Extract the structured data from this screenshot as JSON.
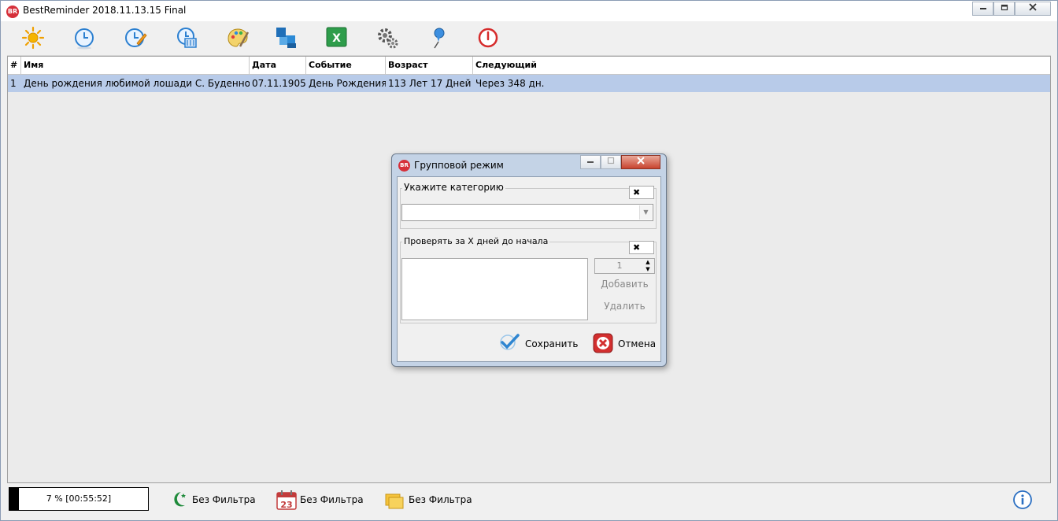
{
  "window": {
    "title": "BestReminder 2018.11.13.15 Final",
    "logo_text": "BR",
    "controls": [
      "minimize",
      "maximize",
      "close"
    ]
  },
  "toolbar": {
    "icons": [
      "sun-settings-icon",
      "clock-icon",
      "clock-edit-icon",
      "clock-delete-icon",
      "palette-icon",
      "blocks-icon",
      "excel-export-icon",
      "gears-icon",
      "pin-icon",
      "power-icon"
    ]
  },
  "table": {
    "columns": [
      "#",
      "Имя",
      "Дата",
      "Событие",
      "Возраст",
      "Следующий"
    ],
    "rows": [
      [
        "1",
        "День рождения любимой лошади С. Буденного",
        "07.11.1905",
        "День Рождения",
        "113 Лет 17 Дней",
        "Через 348 дн."
      ]
    ]
  },
  "dialog": {
    "title": "Групповой режим",
    "logo_text": "BR",
    "category_group_label": "Укажите категорию",
    "category_value": "",
    "check_group_label": "Проверять за X дней до начала",
    "spin_value": "1",
    "add_label": "Добавить",
    "delete_label": "Удалить",
    "save_label": "Сохранить",
    "cancel_label": "Отмена",
    "clear_symbol": "✖"
  },
  "status": {
    "progress_text": "7 % [00:55:52]",
    "progress_fraction": 0.07,
    "filters": [
      {
        "icon": "moon-star-icon",
        "label": "Без Фильтра"
      },
      {
        "icon": "calendar-icon",
        "label": "Без Фильтра",
        "day": "23"
      },
      {
        "icon": "folders-icon",
        "label": "Без Фильтра"
      }
    ],
    "info_icon": "info-icon"
  },
  "colors": {
    "selection": "#b8cbe9",
    "brand": "#d6303a",
    "dialog_frame": "#c4d3e6"
  }
}
